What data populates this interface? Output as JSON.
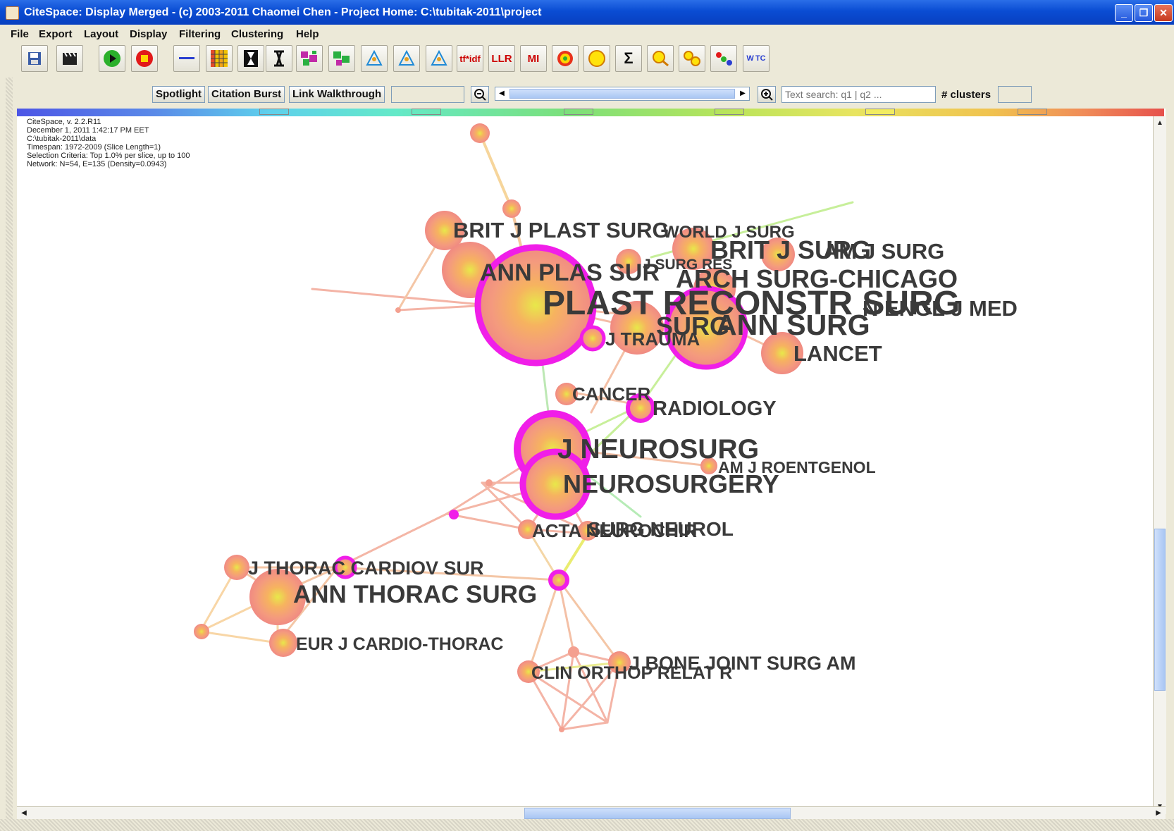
{
  "window": {
    "title": "CiteSpace: Display Merged - (c) 2003-2011 Chaomei Chen - Project Home: C:\\tubitak-2011\\project",
    "minimize": "_",
    "maximize": "❐",
    "close": "✕"
  },
  "menu": [
    "File",
    "Export",
    "Layout",
    "Display",
    "Filtering",
    "Clustering",
    "Help"
  ],
  "toolbar": {
    "tfidf": "tf*idf",
    "llr": "LLR",
    "mi": "MI",
    "sigma": "Σ",
    "wtc": "W TC"
  },
  "controls": {
    "spotlight": "Spotlight",
    "citation_burst": "Citation Burst",
    "link_walkthrough": "Link Walkthrough",
    "search_placeholder": "Text search: q1 | q2 ...",
    "clusters_label": "# clusters"
  },
  "info": {
    "lines": [
      "CiteSpace, v. 2.2.R11",
      "December 1, 2011 1:42:17 PM EET",
      "C:\\tubitak-2011\\data",
      "Timespan: 1972-2009 (Slice Length=1)",
      "Selection Criteria: Top 1.0% per slice, up to 100",
      "Network: N=54, E=135 (Density=0.0943)"
    ]
  },
  "network": {
    "labels": [
      "BRIT J PLAST SURG",
      "WORLD J SURG",
      "BRIT J SURG",
      "AM J SURG",
      "J SURG RES",
      "ANN PLAS SUR",
      "ARCH SURG-CHICAGO",
      "LANCET",
      "PLAST RECONSTR SURG",
      "N ENGL J MED",
      "SURG",
      "ANN SURG",
      "J TRAUMA",
      "CANCER",
      "RADIOLOGY",
      "J NEUROSURG",
      "AM J ROENTGENOL",
      "NEUROSURGERY",
      "ACTA NEUROCHIR",
      "SURG NEUROL",
      "J THORAC CARDIOV SUR",
      "ANN THORAC SURG",
      "EUR J CARDIO-THORAC",
      "J BONE JOINT SURG AM",
      "CLIN ORTHOP RELAT R"
    ]
  }
}
